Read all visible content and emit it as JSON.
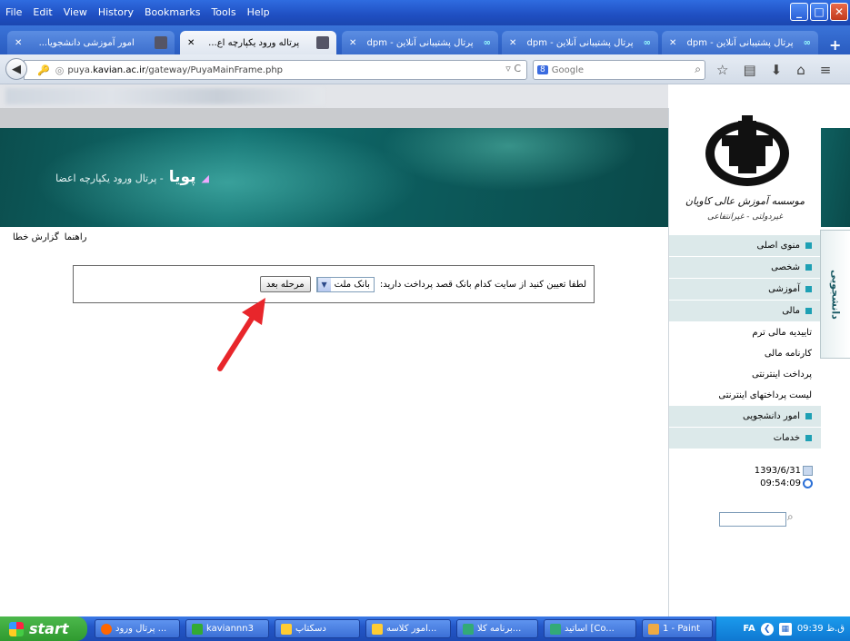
{
  "browser": {
    "menus": [
      "File",
      "Edit",
      "View",
      "History",
      "Bookmarks",
      "Tools",
      "Help"
    ],
    "tabs": [
      {
        "label": "امور آموزشی دانشجویا...",
        "active": false
      },
      {
        "label": "پرتاله ورود یکپارچه اع...",
        "active": true
      },
      {
        "label": "پرتال پشتیبانی آنلاین - dpm",
        "active": false
      },
      {
        "label": "پرتال پشتیبانی آنلاین - dpm",
        "active": false
      },
      {
        "label": "پرتال پشتیبانی آنلاین - dpm",
        "active": false
      }
    ],
    "url_prefix": "puya.",
    "url_domain": "kavian.ac.ir",
    "url_path": "/gateway/PuyaMainFrame.php",
    "search_placeholder": "Google",
    "search_engine": "8"
  },
  "banner": {
    "brand": "پویا",
    "subtitle": "- پرتال ورود یکپارچه اعضا"
  },
  "help_links": [
    "راهنما",
    "گزارش خطا"
  ],
  "main": {
    "prompt": "لطفا تعیین کنید از سایت کدام بانک قصد پرداخت دارید:",
    "bank_selected": "بانک ملت",
    "next_button": "مرحله بعد"
  },
  "sidebar": {
    "logo_caption": "موسسه آموزش عالی کاویان",
    "logo_caption2": "غیردولتی - غیرانتفاعی",
    "menu": [
      {
        "label": "منوی اصلی",
        "type": "hdr"
      },
      {
        "label": "شخصی",
        "type": "hdr"
      },
      {
        "label": "آموزشی",
        "type": "hdr"
      },
      {
        "label": "مالی",
        "type": "hdr"
      },
      {
        "label": "تاییدیه مالی ترم",
        "type": "sub"
      },
      {
        "label": "کارنامه مالی",
        "type": "sub"
      },
      {
        "label": "پرداخت اینترنتی",
        "type": "sub"
      },
      {
        "label": "لیست پرداختهای اینترنتی",
        "type": "sub"
      },
      {
        "label": "امور دانشجویی",
        "type": "hdr"
      },
      {
        "label": "خدمات",
        "type": "hdr"
      }
    ],
    "date": "1393/6/31",
    "time": "09:54:09",
    "vertical_tab": "دانشجویی"
  },
  "taskbar": {
    "start": "start",
    "items": [
      "پرتال ورود ...",
      "kaviannn3",
      "دسکتاپ",
      "امور کلاسه...",
      "برنامه کلا...",
      "اساتید [Co...",
      "1 - Paint"
    ],
    "lang": "FA",
    "clock": "09:39 ق.ظ"
  },
  "colors": {
    "banner": "#0f6666",
    "menu_header_bg": "#dce9ea",
    "menu_bullet": "#1ea0b4",
    "arrow": "#e8262b"
  }
}
